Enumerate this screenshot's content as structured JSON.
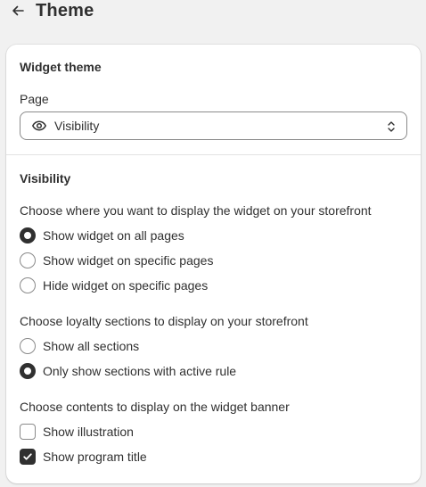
{
  "header": {
    "title": "Theme",
    "back_icon": "arrow-left-icon"
  },
  "widget_theme": {
    "title": "Widget theme",
    "page_label": "Page",
    "page_select": {
      "value": "Visibility",
      "icon": "eye-icon"
    }
  },
  "visibility": {
    "title": "Visibility",
    "display_question": "Choose where you want to display the widget on your storefront",
    "display_options": [
      {
        "label": "Show widget on all pages",
        "checked": true
      },
      {
        "label": "Show widget on specific pages",
        "checked": false
      },
      {
        "label": "Hide widget on specific pages",
        "checked": false
      }
    ],
    "sections_question": "Choose loyalty sections to display on your storefront",
    "sections_options": [
      {
        "label": "Show all sections",
        "checked": false
      },
      {
        "label": "Only show sections with active rule",
        "checked": true
      }
    ],
    "banner_question": "Choose contents to display on the widget banner",
    "banner_options": [
      {
        "label": "Show illustration",
        "checked": false
      },
      {
        "label": "Show program title",
        "checked": true
      }
    ]
  },
  "colors": {
    "background": "#f1f1f1",
    "card": "#ffffff",
    "text": "#303030",
    "border": "#8a8a8a"
  }
}
